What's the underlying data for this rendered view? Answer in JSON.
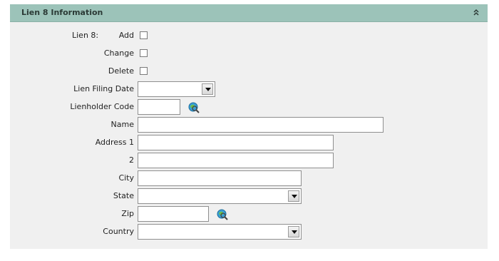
{
  "panel": {
    "title": "Lien 8 Information",
    "collapse_icon": "double-chevron-up-icon"
  },
  "form": {
    "lien_label": "Lien 8:",
    "add_label": "Add",
    "add_checked": false,
    "change_label": "Change",
    "change_checked": false,
    "delete_label": "Delete",
    "delete_checked": false,
    "lien_filing_date_label": "Lien Filing Date",
    "lien_filing_date_value": "",
    "lienholder_code_label": "Lienholder Code",
    "lienholder_code_value": "",
    "lookup_icon": "globe-magnifier-icon",
    "name_label": "Name",
    "name_value": "",
    "address1_label": "Address 1",
    "address1_value": "",
    "address2_label": "2",
    "address2_value": "",
    "city_label": "City",
    "city_value": "",
    "state_label": "State",
    "state_value": "",
    "zip_label": "Zip",
    "zip_value": "",
    "country_label": "Country",
    "country_value": ""
  }
}
